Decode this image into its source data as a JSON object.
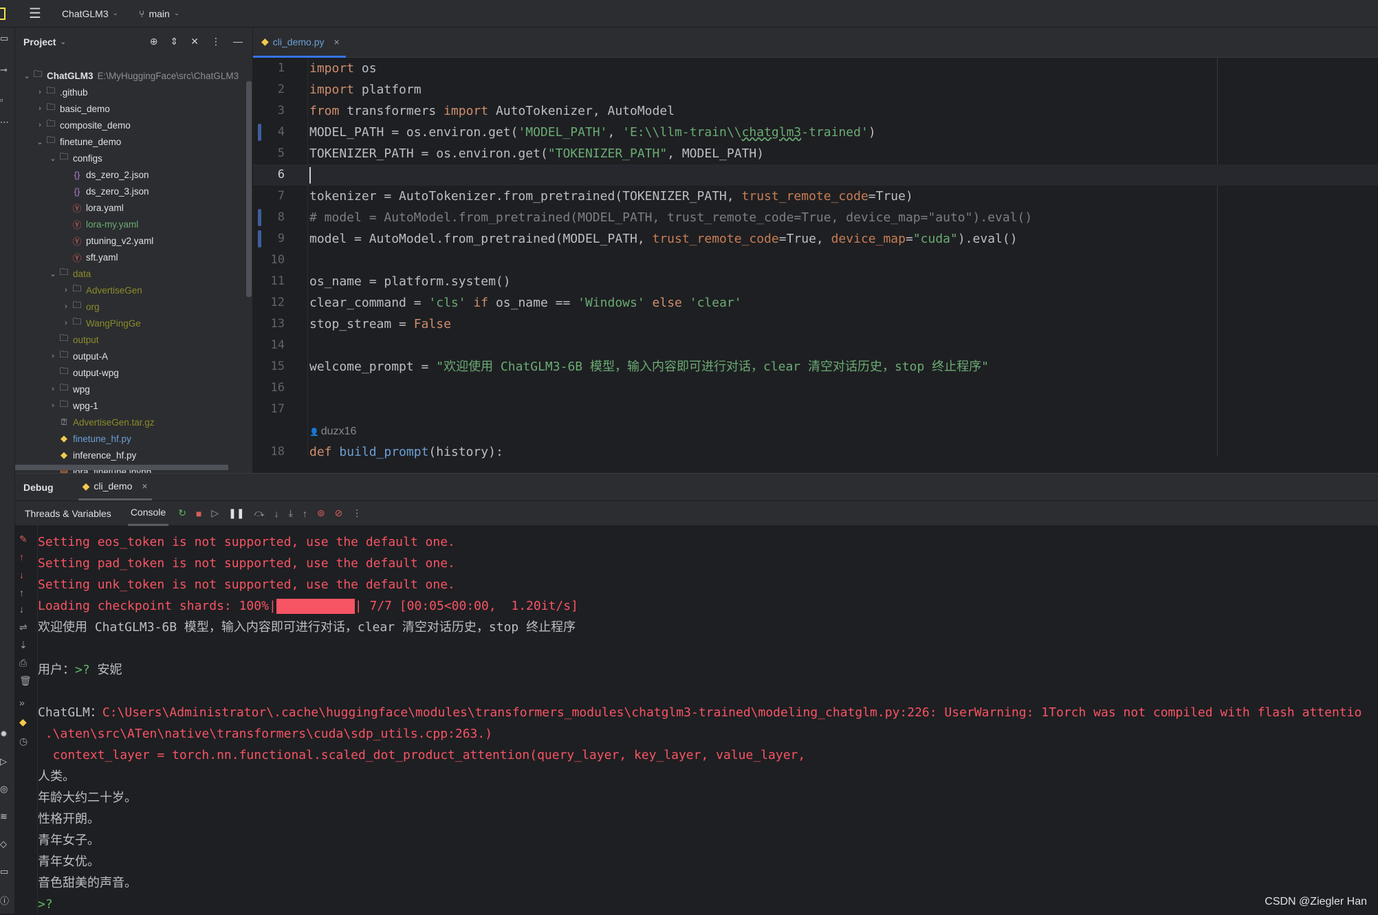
{
  "topbar": {
    "project": "ChatGLM3",
    "branch": "main"
  },
  "project_panel": {
    "title": "Project",
    "tree": [
      {
        "label": "ChatGLM3",
        "path": "E:\\MyHuggingFace\\src\\ChatGLM3",
        "depth": 0,
        "arrow": "open",
        "icon": "folder",
        "color": "bold"
      },
      {
        "label": ".github",
        "depth": 1,
        "arrow": "closed",
        "icon": "folder"
      },
      {
        "label": "basic_demo",
        "depth": 1,
        "arrow": "closed",
        "icon": "folder"
      },
      {
        "label": "composite_demo",
        "depth": 1,
        "arrow": "closed",
        "icon": "folder"
      },
      {
        "label": "finetune_demo",
        "depth": 1,
        "arrow": "open",
        "icon": "folder"
      },
      {
        "label": "configs",
        "depth": 2,
        "arrow": "open",
        "icon": "folder"
      },
      {
        "label": "ds_zero_2.json",
        "depth": 3,
        "icon": "json"
      },
      {
        "label": "ds_zero_3.json",
        "depth": 3,
        "icon": "json"
      },
      {
        "label": "lora.yaml",
        "depth": 3,
        "icon": "yaml"
      },
      {
        "label": "lora-my.yaml",
        "depth": 3,
        "icon": "yaml",
        "color": "green"
      },
      {
        "label": "ptuning_v2.yaml",
        "depth": 3,
        "icon": "yaml"
      },
      {
        "label": "sft.yaml",
        "depth": 3,
        "icon": "yaml"
      },
      {
        "label": "data",
        "depth": 2,
        "arrow": "open",
        "icon": "folder",
        "color": "olive"
      },
      {
        "label": "AdvertiseGen",
        "depth": 3,
        "arrow": "closed",
        "icon": "folder",
        "color": "olive"
      },
      {
        "label": "org",
        "depth": 3,
        "arrow": "closed",
        "icon": "folder",
        "color": "olive"
      },
      {
        "label": "WangPingGe",
        "depth": 3,
        "arrow": "closed",
        "icon": "folder",
        "color": "olive"
      },
      {
        "label": "output",
        "depth": 2,
        "icon": "folder",
        "color": "olive"
      },
      {
        "label": "output-A",
        "depth": 2,
        "arrow": "closed",
        "icon": "folder"
      },
      {
        "label": "output-wpg",
        "depth": 2,
        "icon": "folder"
      },
      {
        "label": "wpg",
        "depth": 2,
        "arrow": "closed",
        "icon": "folder"
      },
      {
        "label": "wpg-1",
        "depth": 2,
        "arrow": "closed",
        "icon": "folder"
      },
      {
        "label": "AdvertiseGen.tar.gz",
        "depth": 2,
        "icon": "unknown",
        "color": "olive"
      },
      {
        "label": "finetune_hf.py",
        "depth": 2,
        "icon": "python",
        "color": "blue"
      },
      {
        "label": "inference_hf.py",
        "depth": 2,
        "icon": "python"
      },
      {
        "label": "lora_finetune.ipynb",
        "depth": 2,
        "icon": "notebook"
      }
    ]
  },
  "editor": {
    "tab": "cli_demo.py",
    "current_line": 6,
    "author": "duzx16",
    "lines": [
      {
        "n": "1",
        "seg": [
          [
            "import",
            "kw"
          ],
          [
            " os",
            ""
          ]
        ]
      },
      {
        "n": "2",
        "seg": [
          [
            "import",
            "kw"
          ],
          [
            " platform",
            ""
          ]
        ]
      },
      {
        "n": "3",
        "seg": [
          [
            "from",
            "kw"
          ],
          [
            " transformers ",
            ""
          ],
          [
            "import",
            "kw"
          ],
          [
            " AutoTokenizer, AutoModel",
            ""
          ]
        ]
      },
      {
        "n": "4",
        "chg": true,
        "seg": [
          [
            "MODEL_PATH = os.environ.get(",
            ""
          ],
          [
            "'MODEL_PATH'",
            "str"
          ],
          [
            ", ",
            ""
          ],
          [
            "'E:\\\\llm-train\\\\",
            "str"
          ],
          [
            "chatglm3",
            "str ul"
          ],
          [
            "-trained'",
            "str"
          ],
          [
            ")",
            ""
          ]
        ]
      },
      {
        "n": "5",
        "seg": [
          [
            "TOKENIZER_PATH = os.environ.get(",
            ""
          ],
          [
            "\"TOKENIZER_PATH\"",
            "str"
          ],
          [
            ", MODEL_PATH)",
            ""
          ]
        ]
      },
      {
        "n": "6",
        "seg": []
      },
      {
        "n": "7",
        "seg": [
          [
            "tokenizer = AutoTokenizer.from_pretrained(TOKENIZER_PATH, ",
            ""
          ],
          [
            "trust_remote_code",
            "param"
          ],
          [
            "=True)",
            ""
          ]
        ]
      },
      {
        "n": "8",
        "chg": true,
        "seg": [
          [
            "# model = AutoModel.from_pretrained(MODEL_PATH, trust_remote_code=True, device_map=\"auto\").eval()",
            "cm"
          ]
        ]
      },
      {
        "n": "9",
        "chg": true,
        "seg": [
          [
            "model = AutoModel.from_pretrained(MODEL_PATH, ",
            ""
          ],
          [
            "trust_remote_code",
            "param"
          ],
          [
            "=True, ",
            ""
          ],
          [
            "device_map",
            "param"
          ],
          [
            "=",
            ""
          ],
          [
            "\"cuda\"",
            "str"
          ],
          [
            ").eval()",
            ""
          ]
        ]
      },
      {
        "n": "10",
        "seg": []
      },
      {
        "n": "11",
        "seg": [
          [
            "os_name = platform.system()",
            ""
          ]
        ]
      },
      {
        "n": "12",
        "seg": [
          [
            "clear_command = ",
            ""
          ],
          [
            "'cls'",
            "str"
          ],
          [
            " ",
            ""
          ],
          [
            "if",
            "kw"
          ],
          [
            " os_name == ",
            ""
          ],
          [
            "'Windows'",
            "str"
          ],
          [
            " ",
            ""
          ],
          [
            "else",
            "kw"
          ],
          [
            " ",
            ""
          ],
          [
            "'clear'",
            "str"
          ]
        ]
      },
      {
        "n": "13",
        "seg": [
          [
            "stop_stream = ",
            ""
          ],
          [
            "False",
            "kw"
          ]
        ]
      },
      {
        "n": "14",
        "seg": []
      },
      {
        "n": "15",
        "seg": [
          [
            "welcome_prompt = ",
            ""
          ],
          [
            "\"欢迎使用 ChatGLM3-6B 模型，输入内容即可进行对话，clear 清空对话历史，stop 终止程序\"",
            "str"
          ]
        ]
      },
      {
        "n": "16",
        "seg": []
      },
      {
        "n": "17",
        "seg": []
      },
      {
        "n": "",
        "author": true,
        "seg": []
      },
      {
        "n": "18",
        "seg": [
          [
            "def",
            "kw"
          ],
          [
            " ",
            ""
          ],
          [
            "build_prompt",
            "c-blue"
          ],
          [
            "(history):",
            ""
          ]
        ]
      }
    ]
  },
  "debug": {
    "title": "Debug",
    "session": "cli_demo",
    "tabs": [
      "Threads & Variables",
      "Console"
    ],
    "console": [
      {
        "seg": [
          [
            "Setting eos_token is not supported, use the default one.",
            "err"
          ]
        ]
      },
      {
        "seg": [
          [
            "Setting pad_token is not supported, use the default one.",
            "err"
          ]
        ]
      },
      {
        "seg": [
          [
            "Setting unk_token is not supported, use the default one.",
            "err"
          ]
        ]
      },
      {
        "progress": 1.0,
        "seg": [
          [
            "Loading checkpoint shards: 100%|",
            "err"
          ],
          [
            "",
            "bar"
          ],
          [
            "| 7/7 [00:05<00:00,  1.20it/s]",
            "err"
          ]
        ]
      },
      {
        "seg": [
          [
            "欢迎使用 ChatGLM3-6B 模型，输入内容即可进行对话，clear 清空对话历史，stop 终止程序",
            "norm"
          ]
        ]
      },
      {
        "seg": []
      },
      {
        "seg": [
          [
            "用户：",
            "norm"
          ],
          [
            ">? ",
            "prompt"
          ],
          [
            "安妮",
            "norm"
          ]
        ]
      },
      {
        "seg": []
      },
      {
        "seg": [
          [
            "ChatGLM：",
            "norm"
          ],
          [
            "C:\\Users\\Administrator\\.cache\\huggingface\\modules\\transformers_modules\\chatglm3-trained\\modeling_chatglm.py:226: UserWarning: 1Torch was not compiled with flash attentio",
            "err"
          ]
        ]
      },
      {
        "seg": [
          [
            " .\\aten\\src\\ATen\\native\\transformers\\cuda\\sdp_utils.cpp:263.)",
            "err"
          ]
        ]
      },
      {
        "seg": [
          [
            "  context_layer = torch.nn.functional.scaled_dot_product_attention(query_layer, key_layer, value_layer,",
            "err"
          ]
        ]
      },
      {
        "seg": [
          [
            "人类。",
            "norm"
          ]
        ]
      },
      {
        "seg": [
          [
            "年龄大约二十岁。",
            "norm"
          ]
        ]
      },
      {
        "seg": [
          [
            "性格开朗。",
            "norm"
          ]
        ]
      },
      {
        "seg": [
          [
            "青年女子。",
            "norm"
          ]
        ]
      },
      {
        "seg": [
          [
            "青年女优。",
            "norm"
          ]
        ]
      },
      {
        "seg": [
          [
            "音色甜美的声音。",
            "norm"
          ]
        ]
      },
      {
        "seg": [
          [
            ">?",
            "prompt"
          ]
        ]
      }
    ]
  },
  "watermark": "CSDN @Ziegler Han"
}
